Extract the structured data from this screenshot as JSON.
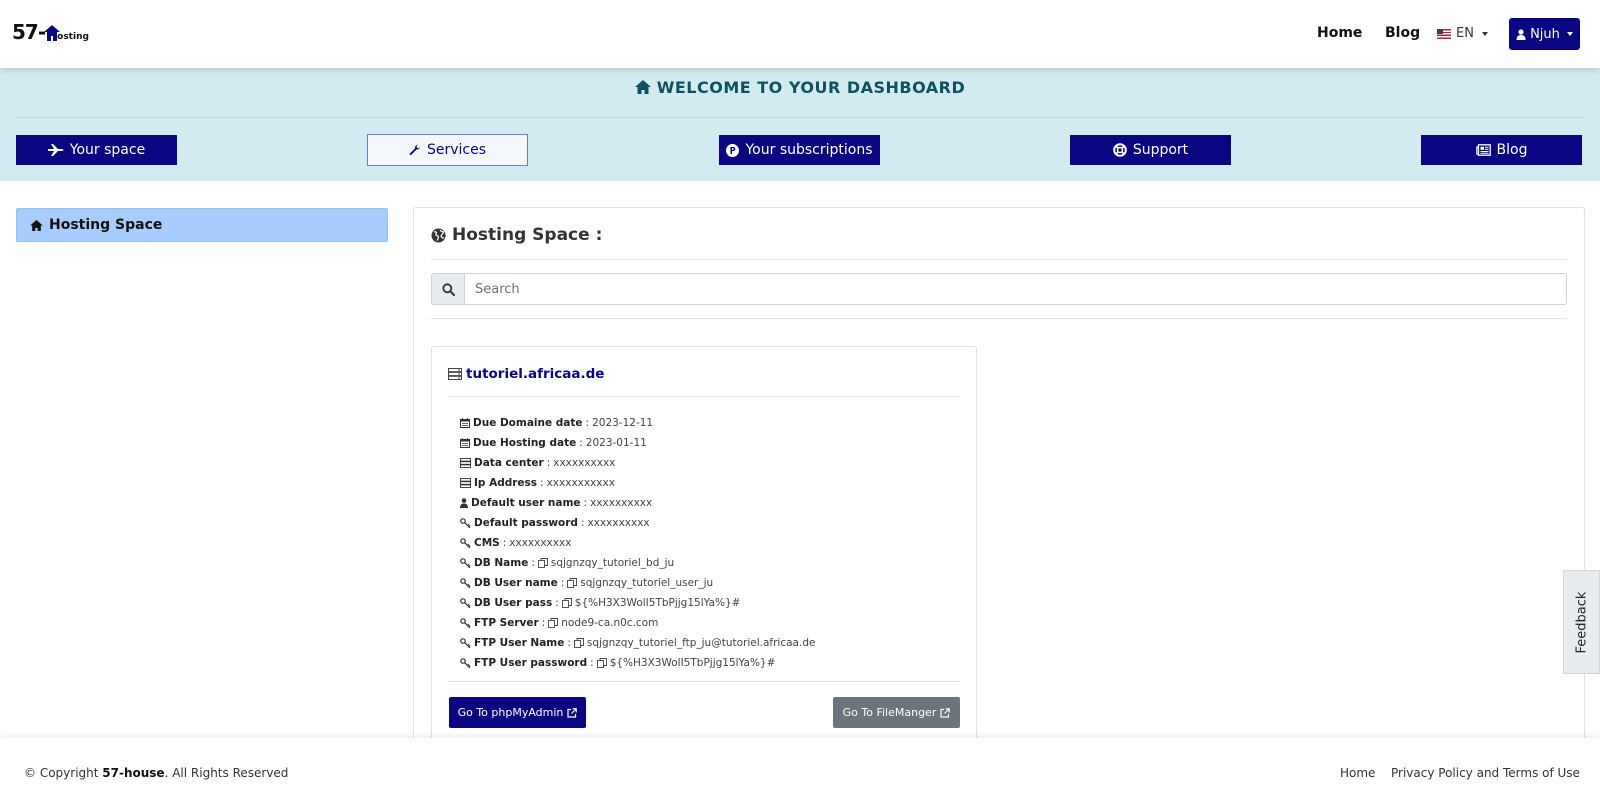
{
  "nav": {
    "logo_number": "57-",
    "logo_word": "osting",
    "links": [
      "Home",
      "Blog"
    ],
    "language": "EN",
    "user": "Njuh"
  },
  "dashboard": {
    "title": "WELCOME TO YOUR DASHBOARD",
    "buttons": [
      {
        "label": "Your space",
        "icon": "fighter-jet-icon"
      },
      {
        "label": "Services",
        "icon": "wrench-icon",
        "active": true
      },
      {
        "label": "Your subscriptions",
        "icon": "parking-icon"
      },
      {
        "label": "Support",
        "icon": "life-ring-icon"
      },
      {
        "label": "Blog",
        "icon": "newspaper-icon"
      }
    ]
  },
  "sidebar": {
    "items": [
      {
        "label": "Hosting Space",
        "icon": "home-icon"
      }
    ]
  },
  "main": {
    "title": "Hosting Space :",
    "search_placeholder": "Search"
  },
  "site": {
    "domain": "tutoriel.africaa.de",
    "fields": [
      {
        "label": "Due Domaine date",
        "value": "2023-12-11",
        "icon": "calendar-icon",
        "copy": false
      },
      {
        "label": "Due Hosting date",
        "value": "2023-01-11",
        "icon": "calendar-icon",
        "copy": false
      },
      {
        "label": "Data center",
        "value": "xxxxxxxxxx",
        "icon": "server-icon",
        "copy": false
      },
      {
        "label": "Ip Address",
        "value": "xxxxxxxxxxx",
        "icon": "server-icon",
        "copy": false
      },
      {
        "label": "Default user name",
        "value": "xxxxxxxxxx",
        "icon": "user-icon",
        "copy": false
      },
      {
        "label": "Default password",
        "value": "xxxxxxxxxx",
        "icon": "key-icon",
        "copy": false
      },
      {
        "label": "CMS",
        "value": "xxxxxxxxxx",
        "icon": "key-icon",
        "copy": false
      },
      {
        "label": "DB Name",
        "value": "sqjgnzqy_tutoriel_bd_ju",
        "icon": "key-icon",
        "copy": true
      },
      {
        "label": "DB User name",
        "value": "sqjgnzqy_tutoriel_user_ju",
        "icon": "key-icon",
        "copy": true
      },
      {
        "label": "DB User pass",
        "value": "${%H3X3WolI5TbPjjg15lYa%}#",
        "icon": "key-icon",
        "copy": true
      },
      {
        "label": "FTP Server",
        "value": "node9-ca.n0c.com",
        "icon": "key-icon",
        "copy": true
      },
      {
        "label": "FTP User Name",
        "value": "sqjgnzqy_tutoriel_ftp_ju@tutoriel.africaa.de",
        "icon": "key-icon",
        "copy": true
      },
      {
        "label": "FTP User password",
        "value": "${%H3X3WolI5TbPjjg15lYa%}#",
        "icon": "key-icon",
        "copy": true
      }
    ],
    "btn_phpmyadmin": "Go To phpMyAdmin",
    "btn_filemanager": "Go To FileManger"
  },
  "feedback": "Feedback",
  "footer": {
    "copyright_prefix": "© Copyright",
    "company": "57-house",
    "rights": ". All Rights Reserved",
    "links": [
      "Home",
      "Privacy Policy and Terms of Use"
    ]
  },
  "colors": {
    "primary": "#0a0580",
    "dash_bg": "#d2ebf1",
    "dash_title": "#0d5263",
    "sidebar_active": "#a6cdfc",
    "secondary": "#6c757d"
  }
}
